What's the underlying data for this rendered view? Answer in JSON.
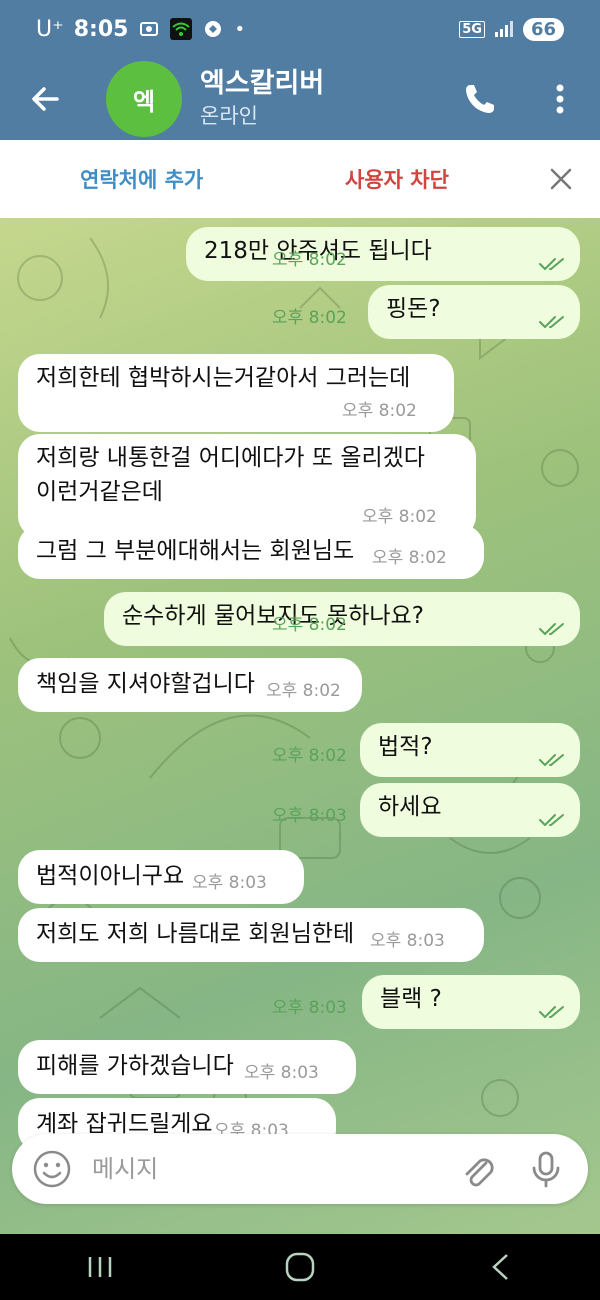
{
  "status_bar": {
    "carrier": "U⁺",
    "time": "8:05",
    "network": "5G",
    "battery": "66"
  },
  "header": {
    "avatar_initial": "엑",
    "title": "엑스칼리버",
    "subtitle": "온라인"
  },
  "action_strip": {
    "add_contact": "연락처에 추가",
    "block_user": "사용자 차단"
  },
  "messages": [
    {
      "dir": "out",
      "text": "218만 안주셔도 됩니다",
      "time": "오후 8:02"
    },
    {
      "dir": "out",
      "text": "핑돈?",
      "time": "오후 8:02"
    },
    {
      "dir": "in",
      "text": "저희한테 협박하시는거같아서 그러는데",
      "time": "오후 8:02"
    },
    {
      "dir": "in",
      "text": "저희랑 내통한걸 어디에다가 또 올리겠다",
      "text2": "이런거같은데",
      "time": "오후 8:02"
    },
    {
      "dir": "in",
      "text": "그럼 그 부분에대해서는 회원님도",
      "time": "오후 8:02"
    },
    {
      "dir": "out",
      "text": "순수하게 물어보지도 못하나요?",
      "time": "오후 8:02"
    },
    {
      "dir": "in",
      "text": "책임을 지셔야할겁니다",
      "time": "오후 8:02"
    },
    {
      "dir": "out",
      "text": "법적?",
      "time": "오후 8:02"
    },
    {
      "dir": "out",
      "text": "하세요",
      "time": "오후 8:03"
    },
    {
      "dir": "in",
      "text": "법적이아니구요",
      "time": "오후 8:03"
    },
    {
      "dir": "in",
      "text": "저희도 저희 나름대로 회원님한테",
      "time": "오후 8:03"
    },
    {
      "dir": "out",
      "text": "블랙 ?",
      "time": "오후 8:03"
    },
    {
      "dir": "in",
      "text": "피해를 가하겠습니다",
      "time": "오후 8:03"
    },
    {
      "dir": "in",
      "text": "계좌 잡귀드릴게요",
      "time": "오후 8:03"
    }
  ],
  "input": {
    "placeholder": "메시지"
  },
  "colors": {
    "header_bg": "#527da3",
    "incoming_bubble": "#ffffff",
    "outgoing_bubble": "#effdde",
    "add_contact": "#3f8ec6",
    "block_user": "#d1443f",
    "avatar": "#5cbf3f"
  },
  "icons": [
    "back-arrow-icon",
    "phone-icon",
    "more-vert-icon",
    "close-icon",
    "emoji-icon",
    "attach-icon",
    "mic-icon",
    "read-ticks-icon",
    "nav-recents-icon",
    "nav-home-icon",
    "nav-back-icon"
  ]
}
